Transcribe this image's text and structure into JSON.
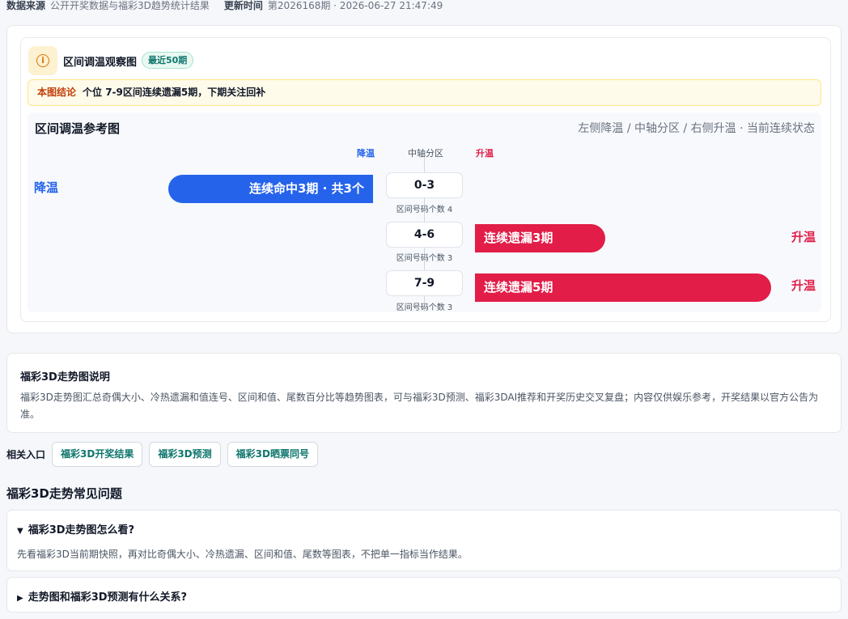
{
  "meta": {
    "source_label": "数据来源",
    "source_value": "公开开奖数据与福彩3D趋势统计结果",
    "update_label": "更新时间",
    "update_value": "第2026168期 · 2026-06-27 21:47:49"
  },
  "panel": {
    "icon": "info-icon",
    "title": "区间调温观察图",
    "badge": "最近50期",
    "conclusion_label": "本图结论",
    "conclusion_text": "个位 7-9区间连续遗漏5期，下期关注回补"
  },
  "reference": {
    "title": "区间调温参考图",
    "subtitle": "左侧降温 / 中轴分区 / 右侧升温 · 当前连续状态",
    "head_cool": "降温",
    "head_axis": "中轴分区",
    "head_warm": "升温",
    "colors": {
      "cool": "#2563eb",
      "warm": "#e11d48"
    },
    "rows": [
      {
        "zone": "0-3",
        "count_text": "区间号码个数 4",
        "side": "cool",
        "side_label": "降温",
        "bar_text": "连续命中3期 · 共3个",
        "streak": 3
      },
      {
        "zone": "4-6",
        "count_text": "区间号码个数 3",
        "side": "warm",
        "side_label": "升温",
        "bar_text": "连续遗漏3期",
        "streak": 3
      },
      {
        "zone": "7-9",
        "count_text": "区间号码个数 3",
        "side": "warm",
        "side_label": "升温",
        "bar_text": "连续遗漏5期",
        "streak": 5
      }
    ]
  },
  "description": {
    "title": "福彩3D走势图说明",
    "body": "福彩3D走势图汇总奇偶大小、冷热遗漏和值连号、区间和值、尾数百分比等趋势图表，可与福彩3D预测、福彩3DAI推荐和开奖历史交叉复盘；内容仅供娱乐参考，开奖结果以官方公告为准。"
  },
  "related": {
    "label": "相关入口",
    "links": [
      "福彩3D开奖结果",
      "福彩3D预测",
      "福彩3D晒票同号"
    ]
  },
  "faq": {
    "title": "福彩3D走势常见问题",
    "items": [
      {
        "question": "福彩3D走势图怎么看?",
        "answer": "先看福彩3D当前期快照，再对比奇偶大小、冷热遗漏、区间和值、尾数等图表，不把单一指标当作结果。",
        "expanded": true
      },
      {
        "question": "走势图和福彩3D预测有什么关系?",
        "answer": "",
        "expanded": false
      }
    ]
  }
}
